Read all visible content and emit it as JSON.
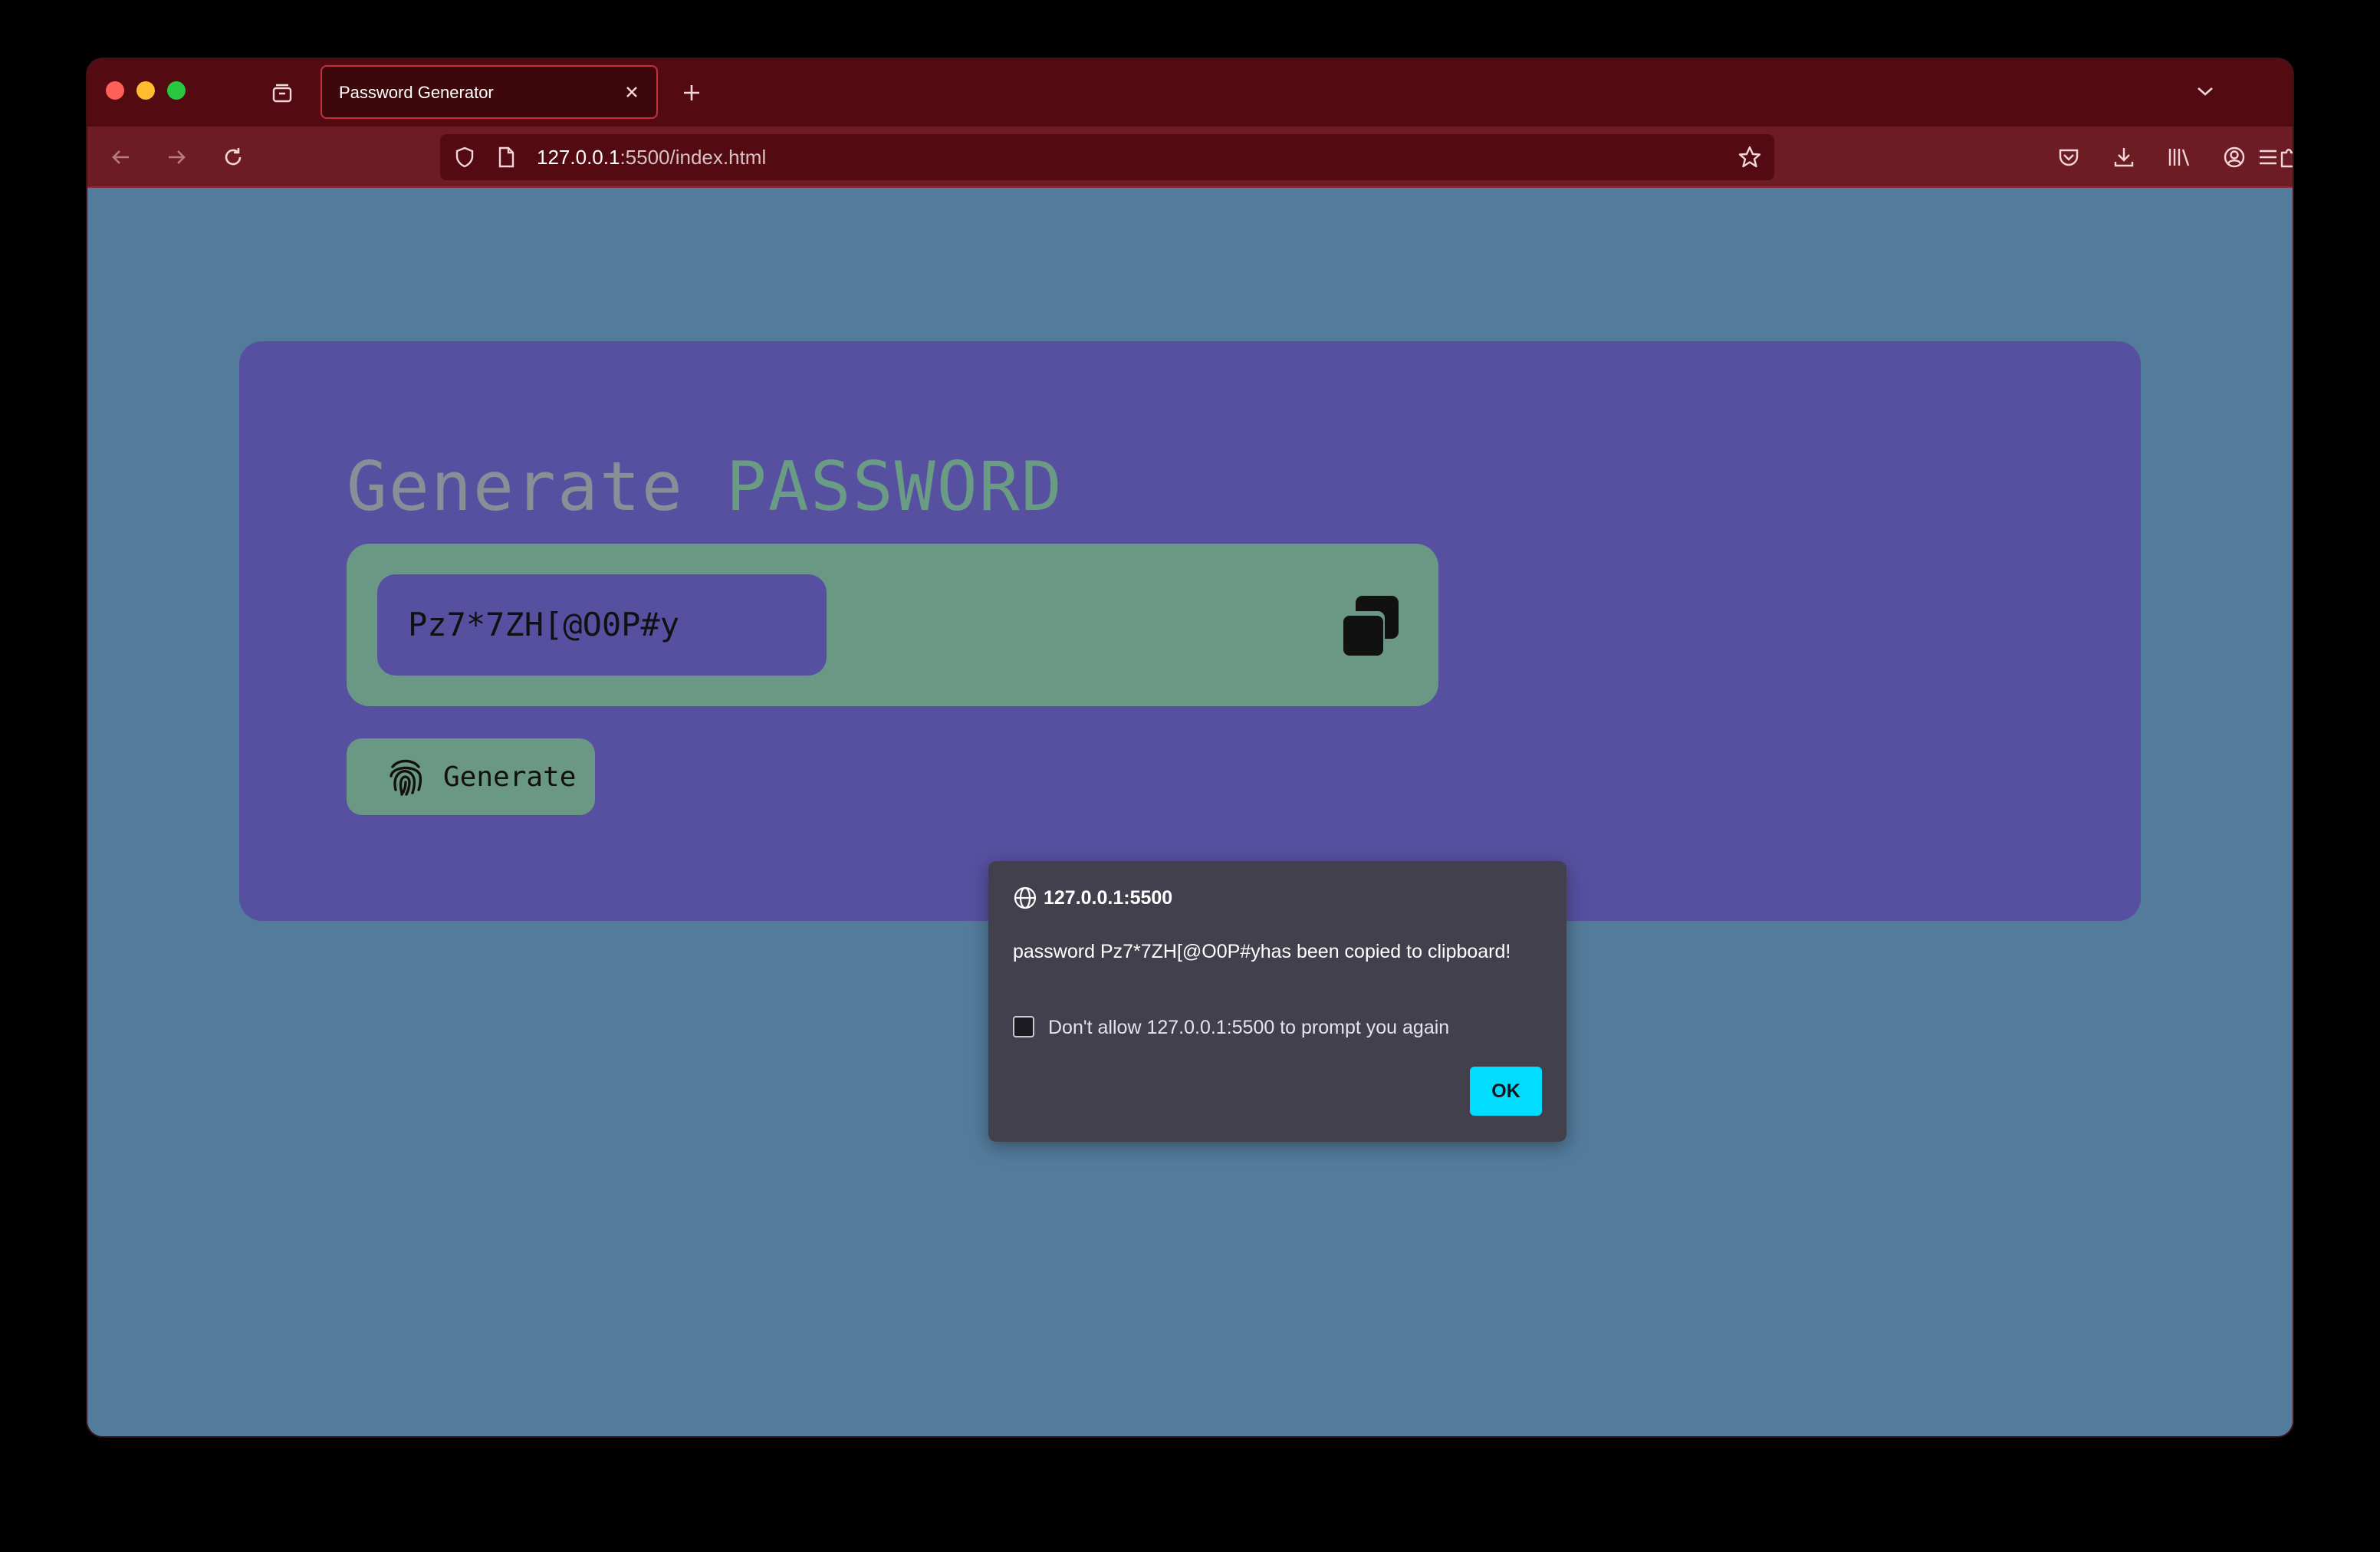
{
  "browser": {
    "tab": {
      "title": "Password Generator"
    },
    "url": {
      "host": "127.0.0.1",
      "rest": ":5500/index.html"
    }
  },
  "page": {
    "headline": {
      "part1": "Generate",
      "part2": "PASSWORD"
    },
    "password_value": "Pz7*7ZH[@O0P#y",
    "generate_label": "Generate"
  },
  "dialog": {
    "origin": "127.0.0.1:5500",
    "message": "password Pz7*7ZH[@O0P#yhas been copied to clipboard!",
    "checkbox_label": "Don't allow 127.0.0.1:5500 to prompt you again",
    "checkbox_checked": false,
    "ok_label": "OK"
  },
  "colors": {
    "page_bg": "#537b9b",
    "card_bg": "#5750a0",
    "accent_green": "#6a9884",
    "dialog_bg": "#42404c",
    "ok_button": "#00ddff"
  }
}
